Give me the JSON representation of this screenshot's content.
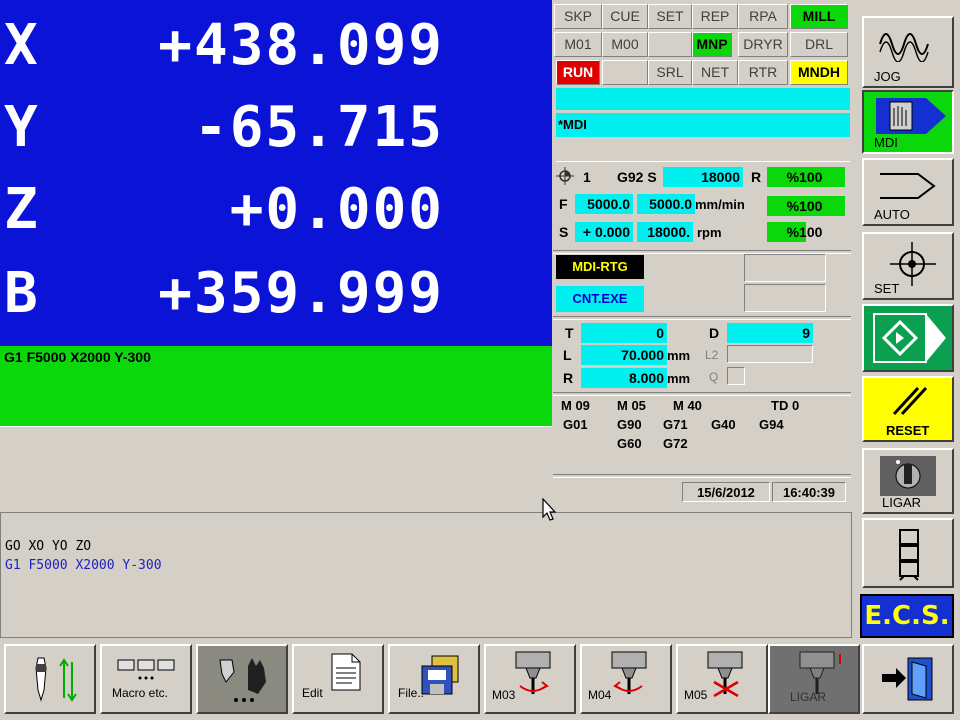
{
  "coords": [
    {
      "axis": "X",
      "value": "+438.099"
    },
    {
      "axis": "Y",
      "value": "-65.715"
    },
    {
      "axis": "Z",
      "value": "+0.000"
    },
    {
      "axis": "B",
      "value": "+359.999"
    }
  ],
  "current_block": "G1 F5000 X2000 Y-300",
  "status_grid": [
    [
      "SKP",
      "CUE",
      "SET",
      "REP",
      "RPA",
      "MILL"
    ],
    [
      "M01",
      "M00",
      "",
      "MNP",
      "DRYR",
      "DRL"
    ],
    [
      "RUN",
      "",
      "SRL",
      "NET",
      "RTR",
      "MNDH"
    ]
  ],
  "mode_line": "*MDI",
  "feed": {
    "tool_num": "1",
    "g92_label": "G92 S",
    "g92_value": "18000",
    "r_label": "R",
    "r_override": "%100",
    "f_label": "F",
    "f_prog": "5000.0",
    "f_actual": "5000.0",
    "f_unit": "mm/min",
    "f_override": "%100",
    "s_label": "S",
    "s_prog": "+ 0.000",
    "s_actual": "18000.",
    "s_unit": "rpm",
    "s_override": "%100"
  },
  "mdi_rtg": "MDI-RTG",
  "cnt_exe": "CNT.EXE",
  "tool": {
    "t_label": "T",
    "t_value": "0",
    "d_label": "D",
    "d_value": "9",
    "l_label": "L",
    "l_value": "70.000",
    "l_unit": "mm",
    "l2_label": "L2",
    "r_label": "R",
    "r_value": "8.000",
    "r_unit": "mm",
    "q_label": "Q"
  },
  "modal": {
    "row1": [
      "M 09",
      "M 05",
      "M 40",
      "TD 0"
    ],
    "row2": [
      "G01",
      "G90",
      "G71",
      "G40",
      "G94"
    ],
    "row3": [
      "G60",
      "G72"
    ]
  },
  "date": "15/6/2012",
  "time": "16:40:39",
  "mdi_lines": [
    {
      "text": "GO XO YO ZO",
      "color": "#000000"
    },
    {
      "text": "G1 F5000 X2000 Y-300",
      "color": "#2020c0"
    }
  ],
  "side_buttons": {
    "jog": "JOG",
    "mdi": "MDI",
    "auto": "AUTO",
    "set": "SET",
    "reset": "RESET",
    "ligar": "LIGAR",
    "ecs": "E.C.S."
  },
  "bottom_buttons": {
    "macro": "Macro etc.",
    "edit": "Edit",
    "file": "File",
    "m03": "M03",
    "m04": "M04",
    "m05": "M05",
    "ligar": "LIGAR"
  },
  "colors": {
    "coord_bg": "#0b14d6",
    "active_green": "#0bd80b",
    "field_cyan": "#00f0f0",
    "alarm_red": "#e00000",
    "highlight_yellow": "#ffff00"
  }
}
